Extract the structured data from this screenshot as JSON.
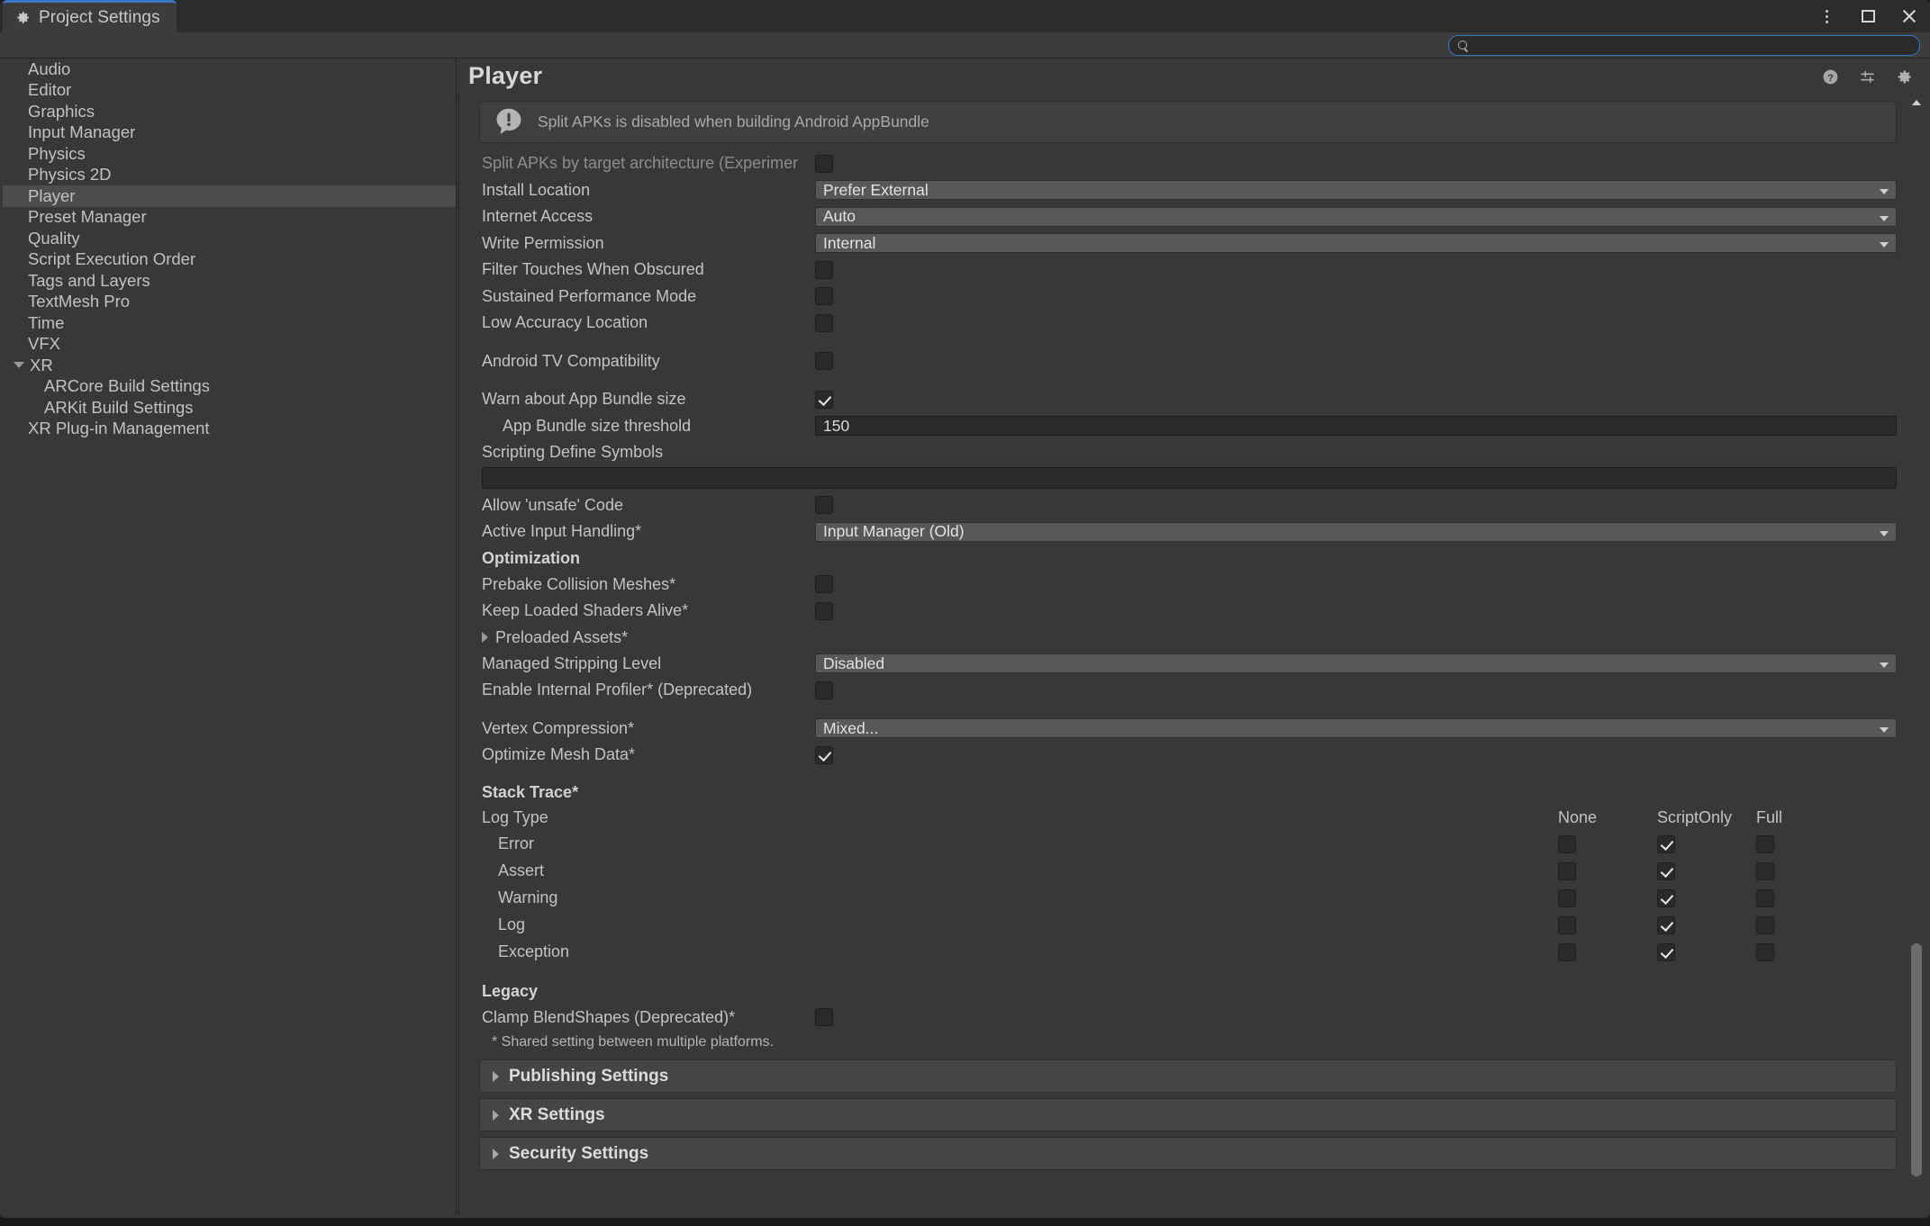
{
  "window": {
    "tab_label": "Project Settings",
    "tab_icon": "gear-icon",
    "controls": {
      "menu": "vertical-dots-icon",
      "maximize": "maximize-icon",
      "close": "close-icon"
    }
  },
  "search": {
    "value": "",
    "placeholder": "",
    "icon": "search-icon"
  },
  "sidebar": {
    "items": [
      {
        "label": "Audio",
        "indent": 0,
        "selected": false,
        "arrow": "none"
      },
      {
        "label": "Editor",
        "indent": 0,
        "selected": false,
        "arrow": "none"
      },
      {
        "label": "Graphics",
        "indent": 0,
        "selected": false,
        "arrow": "none"
      },
      {
        "label": "Input Manager",
        "indent": 0,
        "selected": false,
        "arrow": "none"
      },
      {
        "label": "Physics",
        "indent": 0,
        "selected": false,
        "arrow": "none"
      },
      {
        "label": "Physics 2D",
        "indent": 0,
        "selected": false,
        "arrow": "none"
      },
      {
        "label": "Player",
        "indent": 0,
        "selected": true,
        "arrow": "none"
      },
      {
        "label": "Preset Manager",
        "indent": 0,
        "selected": false,
        "arrow": "none"
      },
      {
        "label": "Quality",
        "indent": 0,
        "selected": false,
        "arrow": "none"
      },
      {
        "label": "Script Execution Order",
        "indent": 0,
        "selected": false,
        "arrow": "none"
      },
      {
        "label": "Tags and Layers",
        "indent": 0,
        "selected": false,
        "arrow": "none"
      },
      {
        "label": "TextMesh Pro",
        "indent": 0,
        "selected": false,
        "arrow": "none"
      },
      {
        "label": "Time",
        "indent": 0,
        "selected": false,
        "arrow": "none"
      },
      {
        "label": "VFX",
        "indent": 0,
        "selected": false,
        "arrow": "none"
      },
      {
        "label": "XR",
        "indent": 0,
        "selected": false,
        "arrow": "down"
      },
      {
        "label": "ARCore Build Settings",
        "indent": 1,
        "selected": false,
        "arrow": "none"
      },
      {
        "label": "ARKit Build Settings",
        "indent": 1,
        "selected": false,
        "arrow": "none"
      },
      {
        "label": "XR Plug-in Management",
        "indent": 0,
        "selected": false,
        "arrow": "none"
      }
    ]
  },
  "panel": {
    "title": "Player",
    "icons": [
      "help-icon",
      "preset-icon",
      "gear-icon"
    ],
    "helpbox": {
      "icon": "info-bubble-icon",
      "message": "Split APKs is disabled when building Android AppBundle"
    },
    "rows": [
      {
        "type": "checkbox",
        "label": "Split APKs by target architecture (Experimer",
        "dim": true,
        "checked": false,
        "name": "split-apks-by-target-architecture"
      },
      {
        "type": "dropdown",
        "label": "Install Location",
        "value": "Prefer External",
        "name": "install-location"
      },
      {
        "type": "dropdown",
        "label": "Internet Access",
        "value": "Auto",
        "name": "internet-access"
      },
      {
        "type": "dropdown",
        "label": "Write Permission",
        "value": "Internal",
        "name": "write-permission"
      },
      {
        "type": "checkbox",
        "label": "Filter Touches When Obscured",
        "checked": false,
        "name": "filter-touches-when-obscured"
      },
      {
        "type": "checkbox",
        "label": "Sustained Performance Mode",
        "checked": false,
        "name": "sustained-performance-mode"
      },
      {
        "type": "checkbox",
        "label": "Low Accuracy Location",
        "checked": false,
        "name": "low-accuracy-location"
      },
      {
        "type": "checkbox",
        "label": "Android TV Compatibility",
        "checked": false,
        "gap": true,
        "name": "android-tv-compatibility"
      },
      {
        "type": "checkbox",
        "label": "Warn about App Bundle size",
        "checked": true,
        "gap": true,
        "name": "warn-about-app-bundle-size"
      },
      {
        "type": "number",
        "label": "App Bundle size threshold",
        "value": "150",
        "indent": true,
        "name": "app-bundle-size-threshold"
      }
    ],
    "scripting_define": {
      "label": "Scripting Define Symbols",
      "value": ""
    },
    "rows2": [
      {
        "type": "checkbox",
        "label": "Allow 'unsafe' Code",
        "checked": false,
        "name": "allow-unsafe-code"
      },
      {
        "type": "dropdown",
        "label": "Active Input Handling*",
        "value": "Input Manager (Old)",
        "name": "active-input-handling"
      }
    ],
    "optimization": {
      "header": "Optimization",
      "rows": [
        {
          "type": "checkbox",
          "label": "Prebake Collision Meshes*",
          "checked": false,
          "name": "prebake-collision-meshes"
        },
        {
          "type": "checkbox",
          "label": "Keep Loaded Shaders Alive*",
          "checked": false,
          "name": "keep-loaded-shaders-alive"
        },
        {
          "type": "foldout",
          "label": "Preloaded Assets*",
          "expanded": false,
          "name": "preloaded-assets"
        },
        {
          "type": "dropdown",
          "label": "Managed Stripping Level",
          "value": "Disabled",
          "name": "managed-stripping-level"
        },
        {
          "type": "checkbox",
          "label": "Enable Internal Profiler* (Deprecated)",
          "checked": false,
          "name": "enable-internal-profiler"
        },
        {
          "type": "dropdown",
          "label": "Vertex Compression*",
          "value": "Mixed...",
          "gap": true,
          "name": "vertex-compression"
        },
        {
          "type": "checkbox",
          "label": "Optimize Mesh Data*",
          "checked": true,
          "name": "optimize-mesh-data"
        }
      ]
    },
    "stack_trace": {
      "header": "Stack Trace*",
      "row_header_label": "Log Type",
      "columns": [
        "None",
        "ScriptOnly",
        "Full"
      ],
      "rows": [
        {
          "label": "Error",
          "values": [
            false,
            true,
            false
          ]
        },
        {
          "label": "Assert",
          "values": [
            false,
            true,
            false
          ]
        },
        {
          "label": "Warning",
          "values": [
            false,
            true,
            false
          ]
        },
        {
          "label": "Log",
          "values": [
            false,
            true,
            false
          ]
        },
        {
          "label": "Exception",
          "values": [
            false,
            true,
            false
          ]
        }
      ]
    },
    "legacy": {
      "header": "Legacy",
      "rows": [
        {
          "type": "checkbox",
          "label": "Clamp BlendShapes (Deprecated)*",
          "checked": false,
          "name": "clamp-blendshapes"
        }
      ]
    },
    "footnote": "* Shared setting between multiple platforms.",
    "collapsible_sections": [
      {
        "label": "Publishing Settings",
        "expanded": false,
        "name": "publishing-settings"
      },
      {
        "label": "XR Settings",
        "expanded": false,
        "name": "xr-settings"
      },
      {
        "label": "Security Settings",
        "expanded": false,
        "name": "security-settings"
      }
    ]
  },
  "colors": {
    "window_bg": "#383838",
    "titlebar_bg": "#2c2c2c",
    "tab_accent": "#3a79c8",
    "selection": "#4d4d4d",
    "field_bg": "#2a2a2a",
    "dropdown_bg": "#585858",
    "text": "#c3c3c3"
  }
}
